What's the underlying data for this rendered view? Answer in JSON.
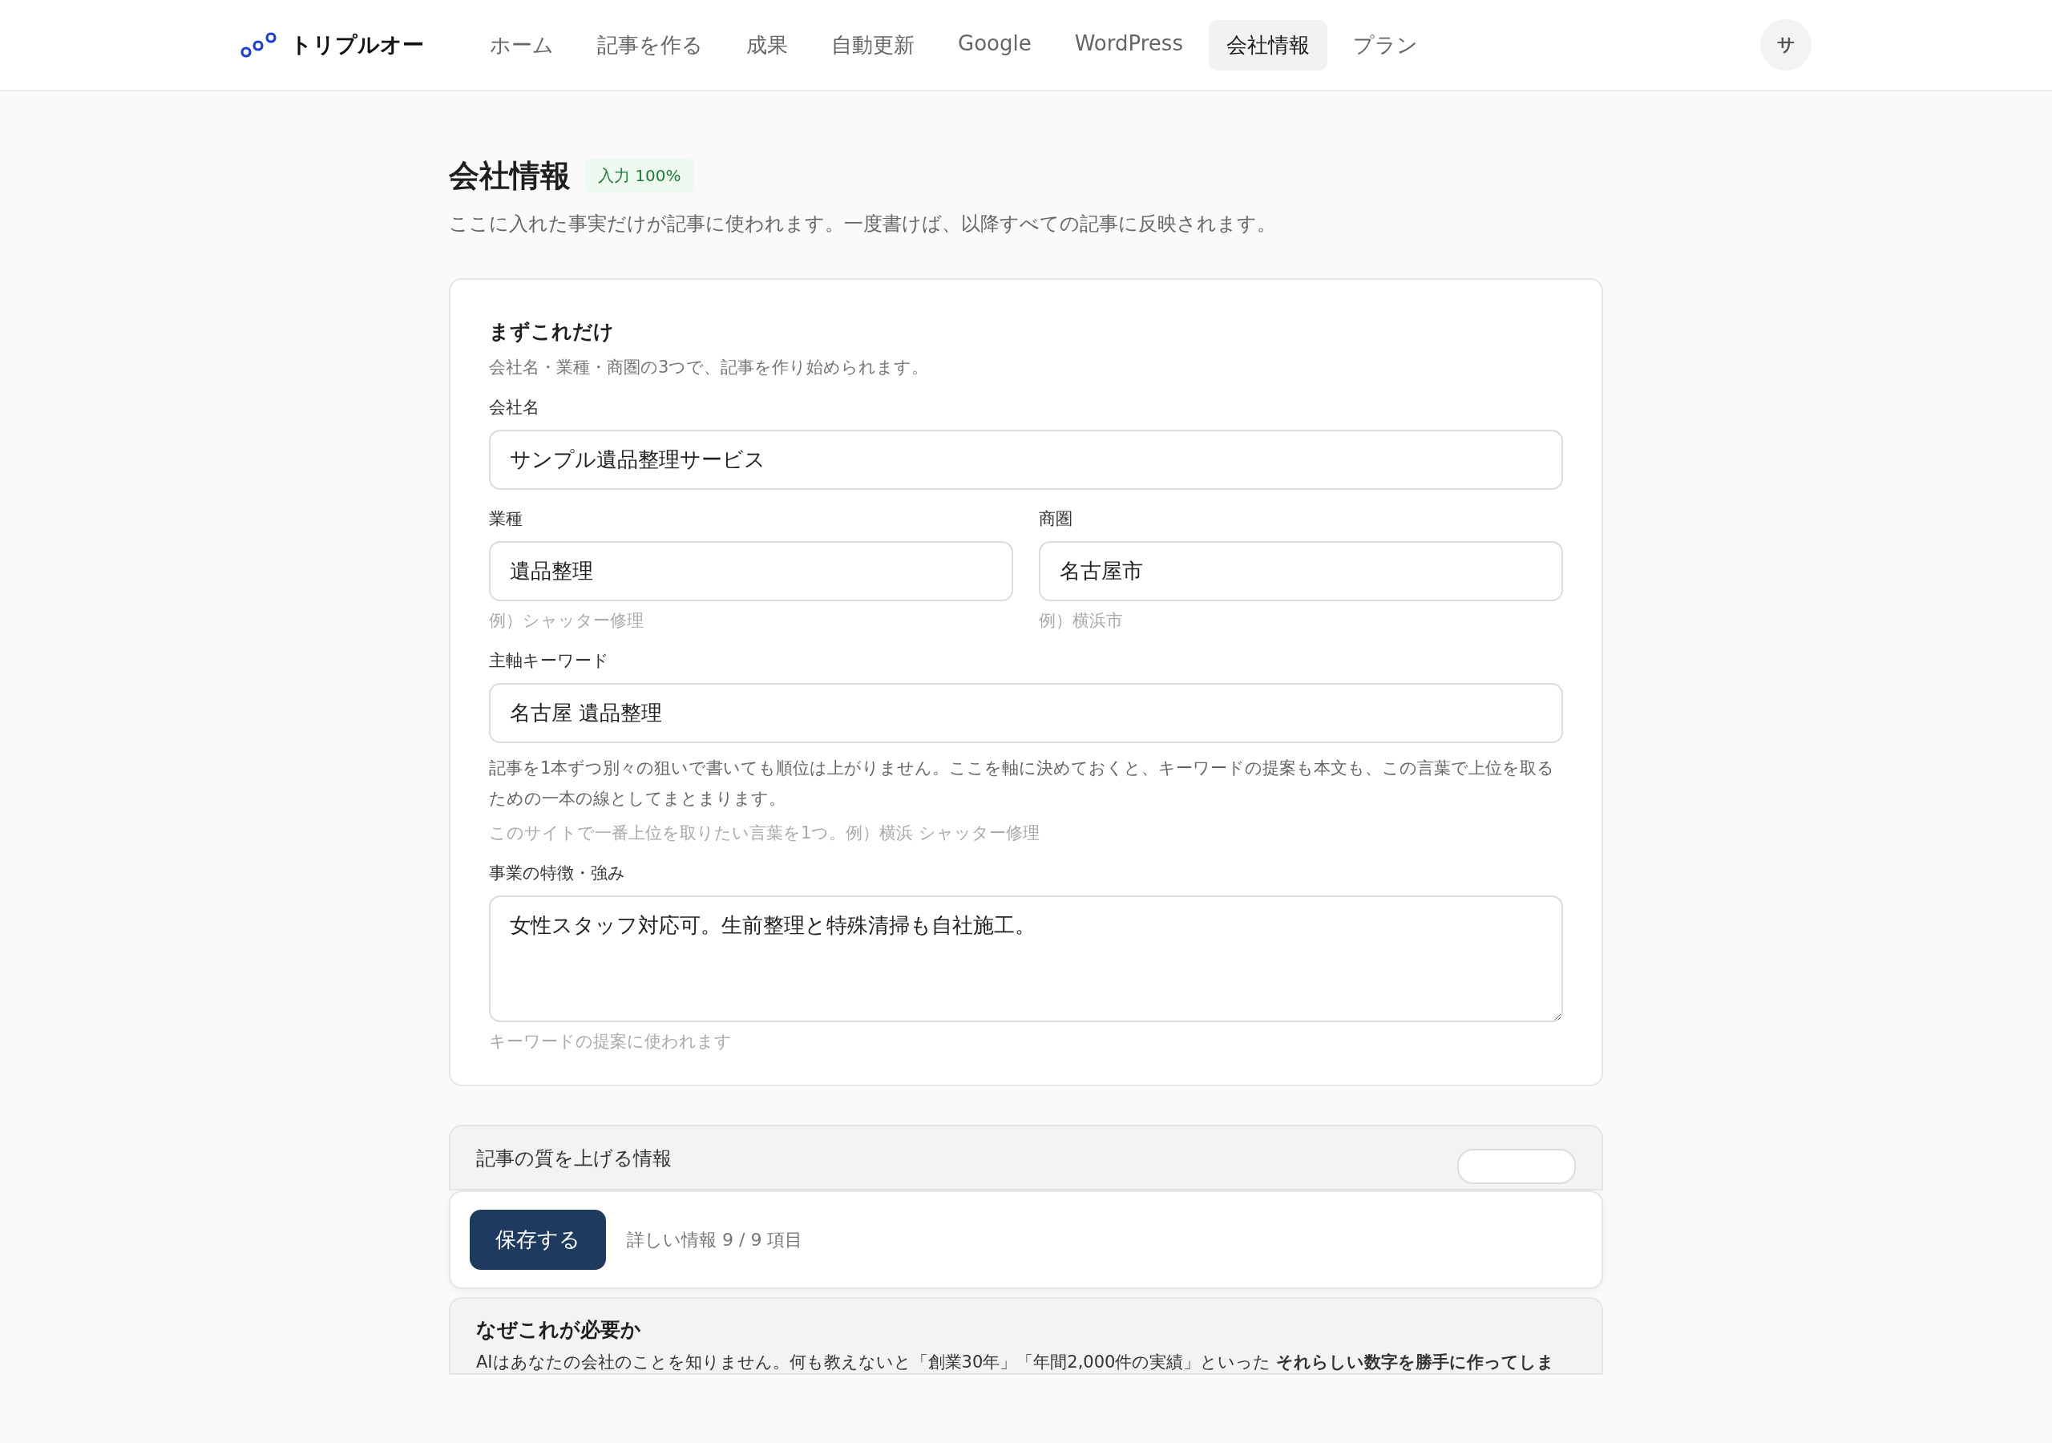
{
  "header": {
    "brand": "トリプルオー",
    "nav": [
      {
        "label": "ホーム",
        "selected": false
      },
      {
        "label": "記事を作る",
        "selected": false
      },
      {
        "label": "成果",
        "selected": false
      },
      {
        "label": "自動更新",
        "selected": false
      },
      {
        "label": "Google",
        "selected": false
      },
      {
        "label": "WordPress",
        "selected": false
      },
      {
        "label": "会社情報",
        "selected": true
      },
      {
        "label": "プラン",
        "selected": false
      }
    ],
    "avatar": "サ"
  },
  "page": {
    "title": "会社情報",
    "badge": "入力 100%",
    "subtitle": "ここに入れた事実だけが記事に使われます。一度書けば、以降すべての記事に反映されます。"
  },
  "basics": {
    "title": "まずこれだけ",
    "subtitle": "会社名・業種・商圏の3つで、記事を作り始められます。",
    "fields": [
      {
        "kind": "text",
        "label": "会社名",
        "value": "サンプル遺品整理サービス"
      },
      {
        "kind": "pair",
        "fields": [
          {
            "label": "業種",
            "value": "遺品整理",
            "hint": "例）シャッター修理"
          },
          {
            "label": "商圏",
            "value": "名古屋市",
            "hint": "例）横浜市"
          }
        ]
      },
      {
        "kind": "text",
        "label": "主軸キーワード",
        "value": "名古屋 遺品整理",
        "note": "記事を1本ずつ別々の狙いで書いても順位は上がりません。ここを軸に決めておくと、キーワードの提案も本文も、この言葉で上位を取るための一本の線としてまとまります。",
        "hint": "このサイトで一番上位を取りたい言葉を1つ。例）横浜 シャッター修理"
      },
      {
        "kind": "textarea",
        "label": "事業の特徴・強み",
        "value": "女性スタッフ対応可。生前整理と特殊清掃も自社施工。",
        "hint": "キーワードの提案に使われます"
      }
    ]
  },
  "details": {
    "title": "記事の質を上げる情報"
  },
  "save_bar": {
    "button": "保存する",
    "status": "詳しい情報 9 / 9 項目"
  },
  "why": {
    "title": "なぜこれが必要か",
    "text": "AIはあなたの会社のことを知りません。何も教えないと「創業30年」「年間2,000件の実績」といった **それらしい数字を勝手に作ってしま**"
  }
}
